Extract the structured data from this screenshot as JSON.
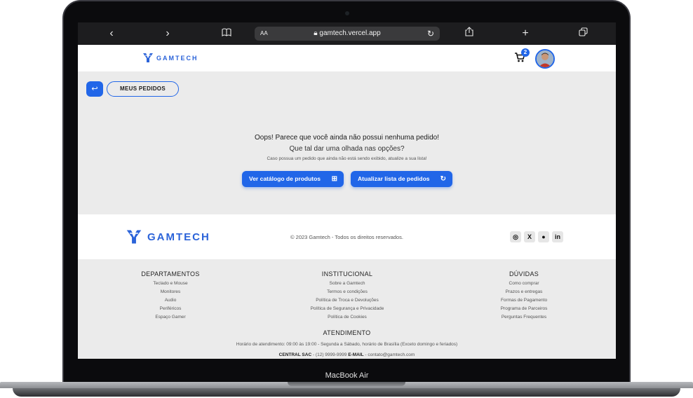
{
  "device": {
    "label": "MacBook Air"
  },
  "browser": {
    "url": "gamtech.vercel.app",
    "text_size": "AA",
    "icons": [
      "chevron-left-icon",
      "chevron-right-icon",
      "book-icon",
      "lock-icon",
      "reload-icon",
      "share-icon",
      "plus-icon",
      "tabs-icon"
    ]
  },
  "header": {
    "logo_text": "GAMTECH",
    "cart_count": "2"
  },
  "page": {
    "title": "MEUS PEDIDOS",
    "empty_title": "Oops! Parece que você ainda não possui nenhuma pedido!",
    "empty_sub": "Que tal dar uma olhada nas opções?",
    "empty_hint": "Caso possua um pedido que ainda não está sendo exibido, atualize a sua lista!",
    "catalog_button": "Ver catálogo de produtos",
    "refresh_button": "Atualizar lista de pedidos"
  },
  "footer": {
    "logo_text": "GAMTECH",
    "copyright": "© 2023 Gamtech - Todos os direitos reservados.",
    "socials": [
      "instagram-icon",
      "x-icon",
      "github-icon",
      "linkedin-icon"
    ],
    "social_labels": [
      "◎",
      "X",
      "●",
      "in"
    ],
    "columns": [
      {
        "title": "DEPARTAMENTOS",
        "links": [
          "Teclado e Mouse",
          "Monitores",
          "Audio",
          "Periféricos",
          "Espaço Gamer"
        ]
      },
      {
        "title": "INSTITUCIONAL",
        "links": [
          "Sobre a Gamtech",
          "Termos e condições",
          "Política de Troca e Devoluções",
          "Política de Segurança e Privacidade",
          "Política de Cookies"
        ]
      },
      {
        "title": "DÚVIDAS",
        "links": [
          "Como comprar",
          "Prazos e entregas",
          "Formas de Pagamento",
          "Programa de Parceiros",
          "Perguntas Frequentes"
        ]
      }
    ],
    "attendance": {
      "title": "ATENDIMENTO",
      "hours": "Horário de atendimento: 09:00 às 19:00 - Segunda a Sábado, horário de Brasília (Exceto domingo e feriados)",
      "sac_label": "CENTRAL SAC",
      "sac_value": "- (12) 9999-9999",
      "email_label": "E-MAIL",
      "email_value": "- contato@gamtech.com"
    }
  },
  "colors": {
    "brand": "#2166e8",
    "logo": "#2b63d9",
    "background": "#ebebeb"
  }
}
